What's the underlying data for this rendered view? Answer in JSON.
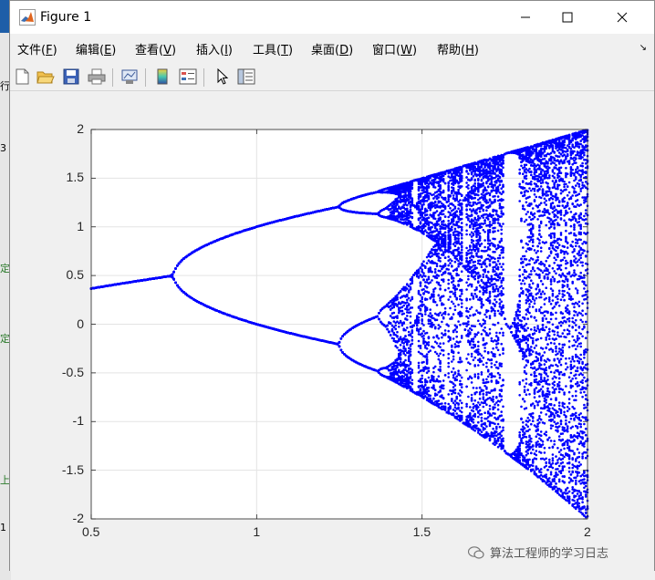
{
  "window": {
    "title": "Figure 1"
  },
  "menu": [
    {
      "label": "文件(",
      "key": "F",
      "end": ")"
    },
    {
      "label": "编辑(",
      "key": "E",
      "end": ")"
    },
    {
      "label": "查看(",
      "key": "V",
      "end": ")"
    },
    {
      "label": "插入(",
      "key": "I",
      "end": ")"
    },
    {
      "label": "工具(",
      "key": "T",
      "end": ")"
    },
    {
      "label": "桌面(",
      "key": "D",
      "end": ")"
    },
    {
      "label": "窗口(",
      "key": "W",
      "end": ")"
    },
    {
      "label": "帮助(",
      "key": "H",
      "end": ")"
    }
  ],
  "toolbar": {
    "icons": [
      "new-figure-icon",
      "open-file-icon",
      "save-icon",
      "print-icon",
      "link-plot-icon",
      "colorbar-icon",
      "legend-icon",
      "pointer-icon",
      "property-inspector-icon"
    ]
  },
  "chart_data": {
    "type": "scatter",
    "description_kind": "bifurcation diagram",
    "color": "#0000ff",
    "xlim": [
      0.5,
      2
    ],
    "ylim": [
      -2,
      2
    ],
    "xticks": [
      "0.5",
      "1",
      "1.5",
      "2"
    ],
    "yticks": [
      "2",
      "1.5",
      "1",
      "0.5",
      "0",
      "-0.5",
      "-1",
      "-1.5",
      "-2"
    ],
    "grid": true,
    "title": "",
    "xlabel": "",
    "ylabel": ""
  },
  "watermark": {
    "text": "算法工程师的学习日志"
  },
  "background": {
    "left_texts": [
      "行",
      "3",
      "定",
      "定",
      "上",
      "1"
    ]
  }
}
